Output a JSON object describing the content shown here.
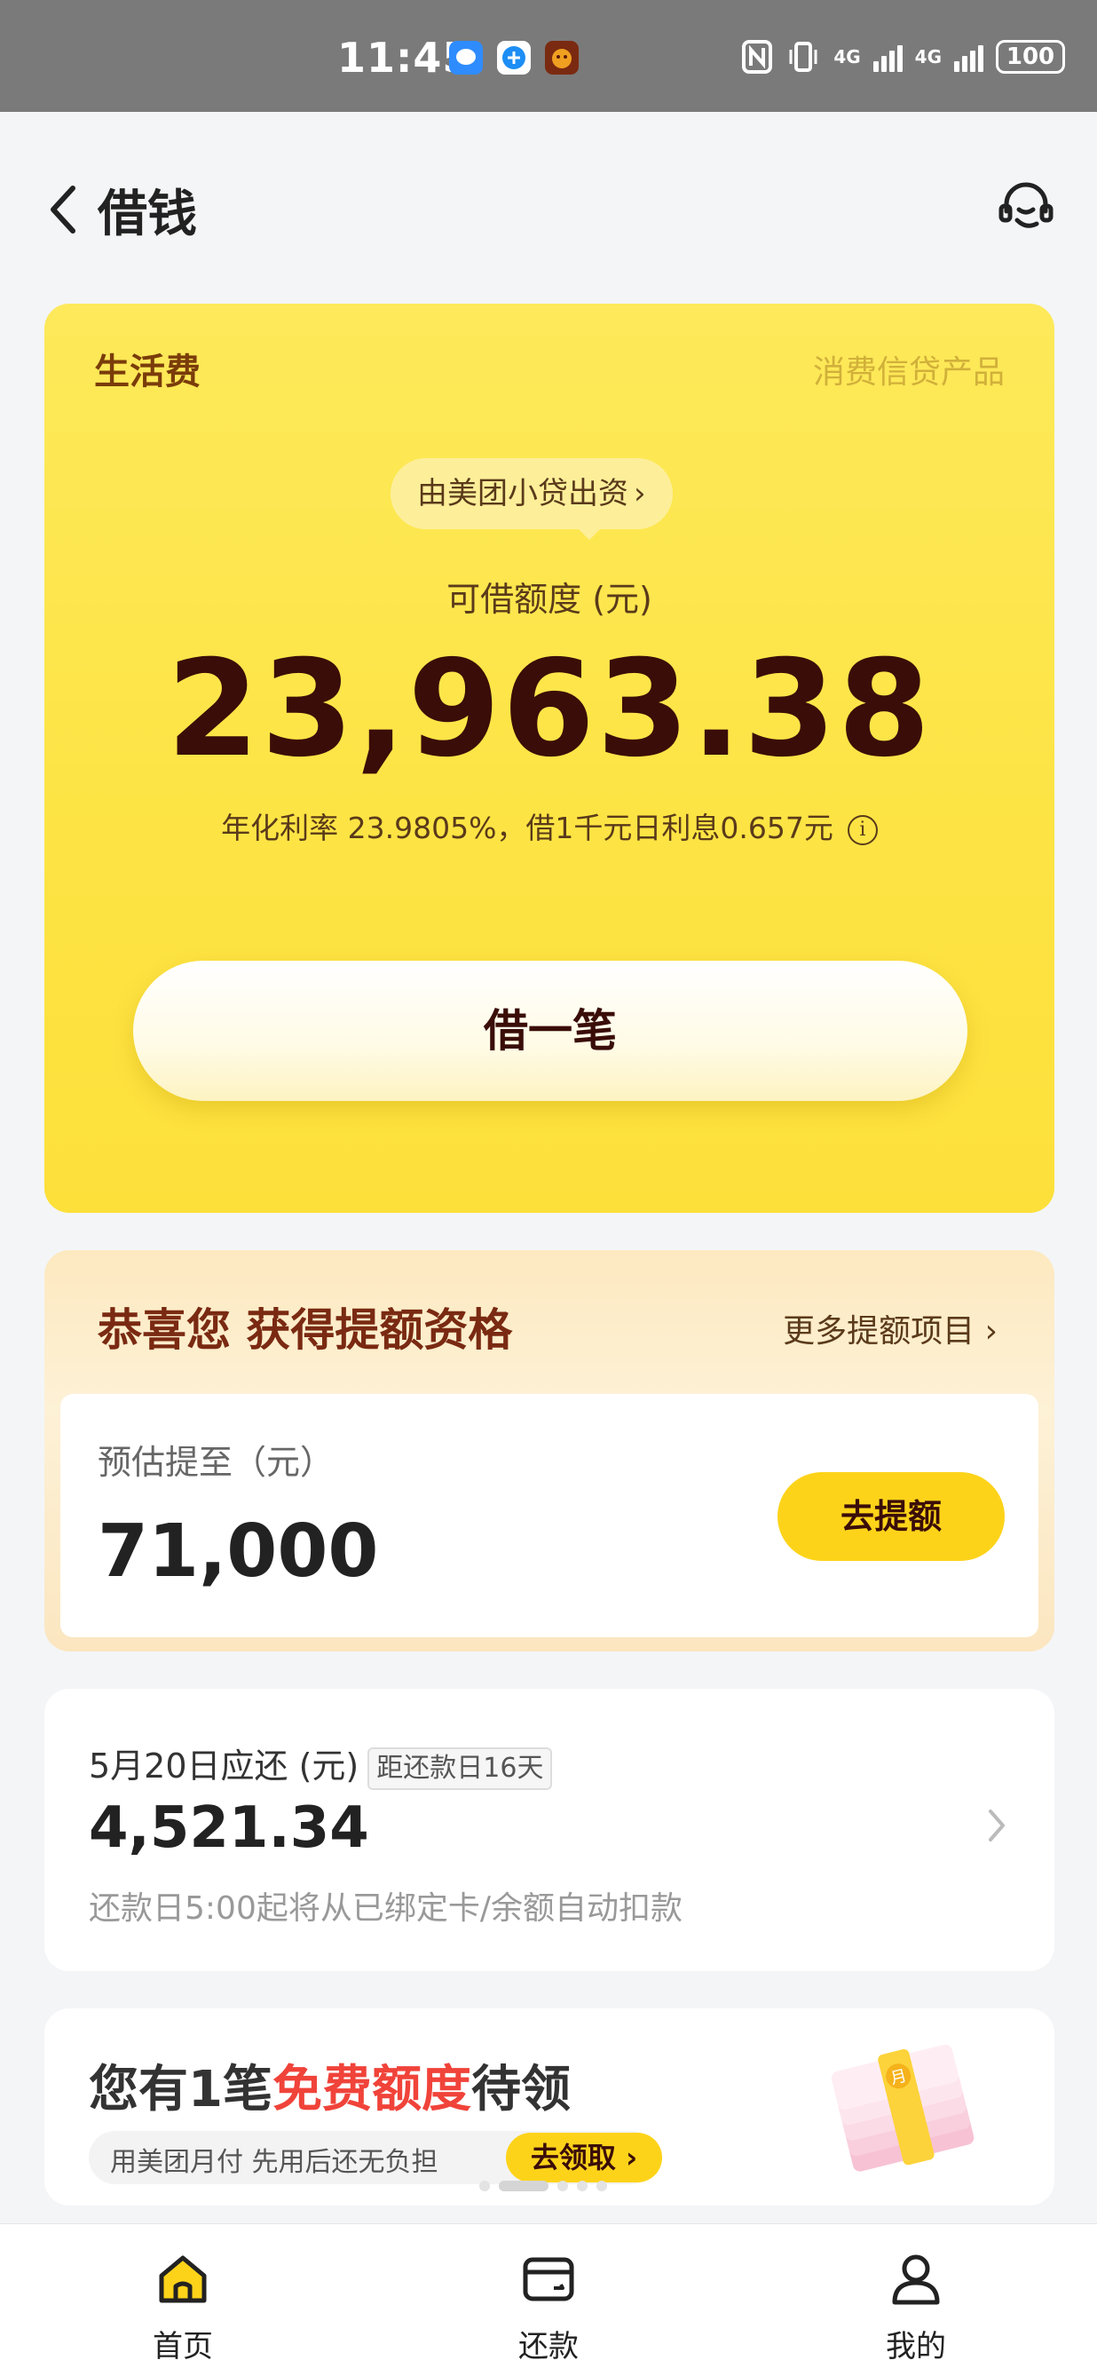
{
  "status_bar": {
    "time": "11:45",
    "signal1": "4G",
    "signal2": "4G",
    "battery": "100"
  },
  "header": {
    "title": "借钱"
  },
  "loan_card": {
    "type": "生活费",
    "tag": "消费信贷产品",
    "lender": "由美团小贷出资",
    "limit_label": "可借额度 (元)",
    "limit_amount": "23,963.38",
    "rate_text": "年化利率 23.9805%，借1千元日利息0.657元",
    "borrow_button": "借一笔"
  },
  "raise_card": {
    "title": "恭喜您 获得提额资格",
    "more": "更多提额项目",
    "label": "预估提至（元）",
    "amount": "71,000",
    "button": "去提额"
  },
  "repay_card": {
    "label": "5月20日应还 (元)",
    "badge": "距还款日16天",
    "amount": "4,521.34",
    "note": "还款日5:00起将从已绑定卡/余额自动扣款"
  },
  "promo": {
    "title_prefix": "您有1笔",
    "title_highlight": "免费额度",
    "title_suffix": "待领",
    "subtitle": "用美团月付 先用后还无负担",
    "claim_button": "去领取",
    "art_label": "月"
  },
  "bottom_nav": {
    "home": "首页",
    "repay": "还款",
    "mine": "我的"
  },
  "colors": {
    "accent_yellow": "#fdd31a",
    "card_yellow": "#fde445",
    "dark_brown": "#3a0d08",
    "promo_red": "#f0433a"
  }
}
